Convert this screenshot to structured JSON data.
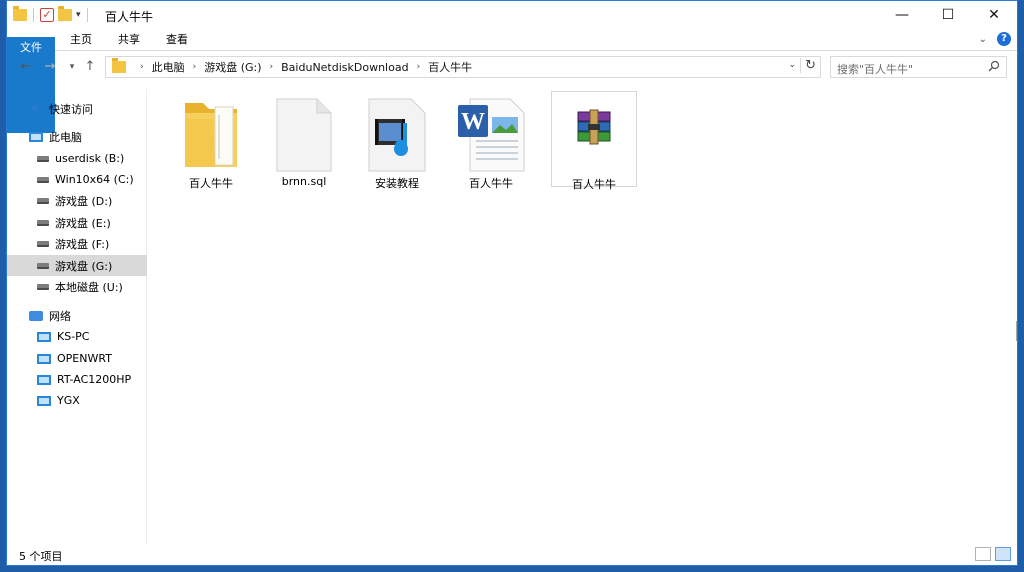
{
  "window": {
    "title": "百人牛牛"
  },
  "ribbon": {
    "tabs": [
      {
        "label": "文件"
      },
      {
        "label": "主页"
      },
      {
        "label": "共享"
      },
      {
        "label": "查看"
      }
    ],
    "help": "?"
  },
  "address": {
    "crumbs": [
      "此电脑",
      "游戏盘 (G:)",
      "BaiduNetdiskDownload",
      "百人牛牛"
    ]
  },
  "search": {
    "placeholder": "搜索\"百人牛牛\""
  },
  "sidebar": {
    "items": [
      {
        "label": "快速访问",
        "icon": "star-icon"
      },
      {
        "label": "此电脑",
        "icon": "pc-icon"
      },
      {
        "label": "userdisk (B:)",
        "icon": "drive-icon"
      },
      {
        "label": "Win10x64 (C:)",
        "icon": "drive-icon"
      },
      {
        "label": "游戏盘 (D:)",
        "icon": "drive-icon"
      },
      {
        "label": "游戏盘 (E:)",
        "icon": "drive-icon"
      },
      {
        "label": "游戏盘 (F:)",
        "icon": "drive-icon"
      },
      {
        "label": "游戏盘 (G:)",
        "icon": "drive-icon"
      },
      {
        "label": "本地磁盘 (U:)",
        "icon": "drive-icon"
      },
      {
        "label": "网络",
        "icon": "network-icon"
      },
      {
        "label": "KS-PC",
        "icon": "computer-icon"
      },
      {
        "label": "OPENWRT",
        "icon": "computer-icon"
      },
      {
        "label": "RT-AC1200HP",
        "icon": "computer-icon"
      },
      {
        "label": "YGX",
        "icon": "computer-icon"
      }
    ]
  },
  "files": [
    {
      "name": "百人牛牛",
      "icon": "folder-icon"
    },
    {
      "name": "brnn.sql",
      "icon": "blank-file-icon"
    },
    {
      "name": "安装教程",
      "icon": "video-file-icon"
    },
    {
      "name": "百人牛牛",
      "icon": "word-document-icon"
    },
    {
      "name": "百人牛牛",
      "icon": "rar-archive-icon"
    }
  ],
  "status": {
    "count": "5 个项目"
  }
}
